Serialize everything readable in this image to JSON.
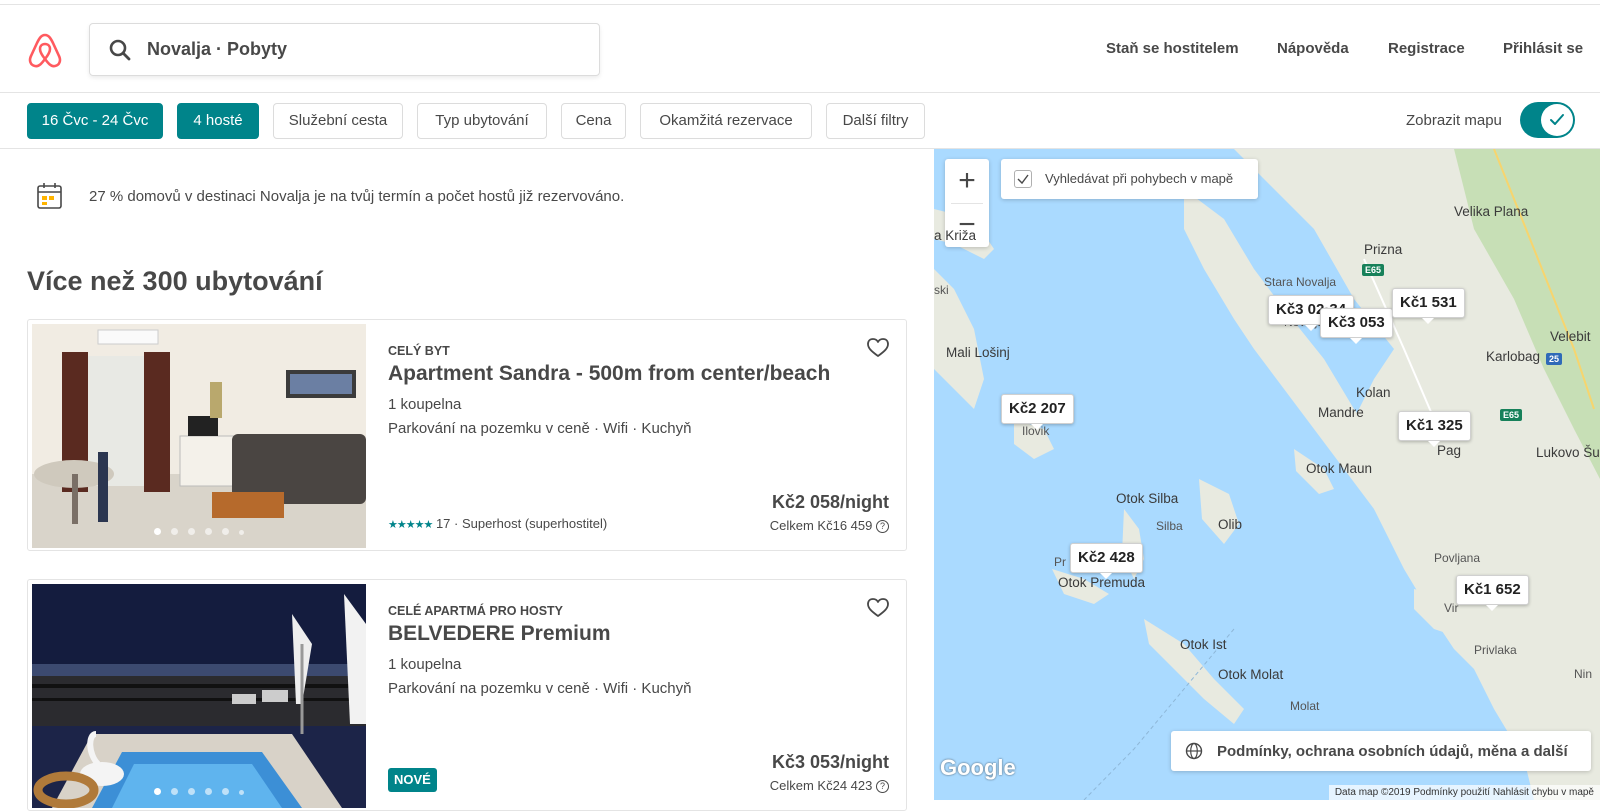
{
  "header": {
    "search_value": "Novalja · Pobyty",
    "nav": [
      "Staň se hostitelem",
      "Nápověda",
      "Registrace",
      "Přihlásit se"
    ]
  },
  "filters": {
    "chips": [
      "16 Čvc - 24 Čvc",
      "4 hosté",
      "Služební cesta",
      "Typ ubytování",
      "Cena",
      "Okamžitá rezervace",
      "Další filtry"
    ],
    "map_toggle_label": "Zobrazit mapu",
    "map_toggle_on": true
  },
  "notice": "27 % domovů v destinaci Novalja je na tvůj termín a počet hostů již rezervováno.",
  "results_title": "Více než 300 ubytování",
  "listings": [
    {
      "kind": "Celý byt",
      "title": "Apartment Sandra - 500m from center/beach",
      "baths": "1 koupelna",
      "amenities": "Parkování na pozemku v ceně · Wifi · Kuchyň",
      "stars": "★★★★★",
      "rating": "17 · Superhost (superhostitel)",
      "price": "Kč2 058/night",
      "total": "Celkem Kč16 459"
    },
    {
      "kind": "Celé apartmá pro hosty",
      "title": "BELVEDERE Premium",
      "baths": "1 koupelna",
      "amenities": "Parkování na pozemku v ceně · Wifi · Kuchyň",
      "badge": "NOVÉ",
      "price": "Kč3 053/night",
      "total": "Celkem Kč24 423"
    }
  ],
  "map": {
    "search_on_move_label": "Vyhledávat při pohybech v mapě",
    "pins": [
      "Kč3 02·34",
      "Kč3 053",
      "Kč1 531",
      "Kč2 207",
      "Kč1 325",
      "Kč2 428",
      "Kč1 652"
    ],
    "places": [
      "Velika Plana",
      "a Križa",
      "Prizna",
      "ski",
      "Stara Novalja",
      "Novalja",
      "Velebit",
      "Mali Lošinj",
      "Karlobag",
      "Kolan",
      "Mandre",
      "Ilovik",
      "Pag",
      "Lukovo Šugarje",
      "Otok Maun",
      "Otok Silba",
      "Silba",
      "Olib",
      "Povljana",
      "Pr",
      "Otok Premuda",
      "Vir",
      "Otok Ist",
      "Privlaka",
      "Otok Molat",
      "Molat",
      "Nin"
    ],
    "roads": [
      "E65",
      "25",
      "E65"
    ],
    "terms": "Podmínky, ochrana osobních údajů, měna a další",
    "google": "Google",
    "attribution": "Data map ©2019    Podmínky použití    Nahlásit chybu v mapě",
    "colors": {
      "water": "#aadaff",
      "land": "#e8eae0",
      "forest": "#c7dfb6"
    }
  },
  "colors": {
    "accent": "#00848a",
    "brand": "#ff5a5f",
    "text": "#484848"
  }
}
